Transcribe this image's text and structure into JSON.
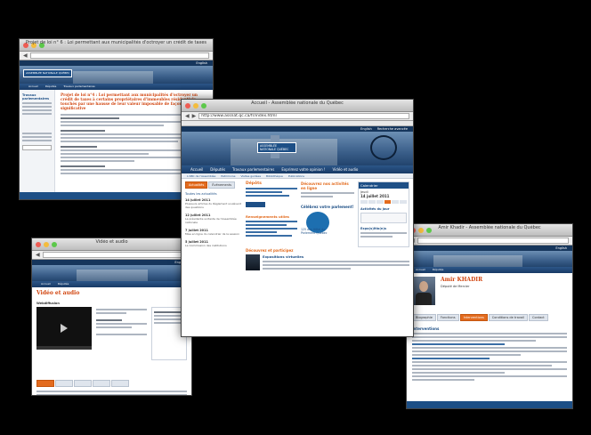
{
  "colors": {
    "background": "#000000",
    "brand_blue": "#1d4f86",
    "accent_orange": "#e36b1e",
    "title_red": "#d1440e"
  },
  "main": {
    "window_title": "Accueil - Assemblée nationale du Québec",
    "url": "http://www.assnat.qc.ca/fr/index.html",
    "search_label": "Recherche avancée",
    "nav_label": "English",
    "banner_logo": "ASSEMBLÉE NATIONALE QUÉBEC",
    "menu": [
      "Accueil",
      "Députés",
      "Travaux parlementaires",
      "Exprimez votre opinion !",
      "Vidéo et audio"
    ],
    "submenu": [
      "L'ABC de l'Assemblée",
      "Patrimoine",
      "Visites guidées",
      "Bibliothèque",
      "Publications"
    ],
    "tabs": [
      "Actualités",
      "Événements",
      "Dépôts"
    ],
    "news_link": "Toutes les actualités",
    "news": [
      {
        "date": "14 juillet 2011",
        "text": "Plusieurs articles du Règlement soulèvent des questions"
      },
      {
        "date": "12 juillet 2011",
        "text": "La présidente sortante de l'Assemblée nationale"
      },
      {
        "date": "7 juillet 2011",
        "text": "Mise en ligne du calendrier de la session"
      },
      {
        "date": "5 juillet 2011",
        "text": "La Commission des institutions"
      }
    ],
    "depots_title": "Dépôts",
    "renseignements_title": "Renseignements utiles",
    "decouvrez_title": "Découvrez et participez",
    "exposition_title": "Expositions virtuelles",
    "nouveau_title": "Découvrez nos activités en ligne",
    "celebrez_title": "Célébrez votre parlement!",
    "anniversary_text": "125 ans Hôtel du Parlement Québec",
    "calendar_title": "Calendrier",
    "calendar_day": "Jeudi",
    "calendar_date": "14 juillet 2011",
    "activites_title": "Activités du jour",
    "expo_title": "Expo(s)itio(n)s"
  },
  "topleft": {
    "window_title": "Projet de loi n° 6 : Loi permettant aux municipalités d'octroyer un crédit de taxes",
    "red_title": "Projet de loi n°4 : Loi permettant aux municipalités d'octroyer un crédit de taxes à certains propriétaires d'immeubles résidentiels touchés par une hausse de leur valeur imposable de façon significative",
    "side_title": "Travaux parlementaires"
  },
  "bottomleft": {
    "window_title": "Vidéo et audio",
    "title": "Vidéo et audio",
    "webdiffusion": "Webdiffusion"
  },
  "right": {
    "window_title": "Amir Khadir - Assemblée nationale du Québec",
    "name": "Amir KHADIR",
    "subtitle": "Député de Mercier",
    "tabs": [
      "Biographie",
      "Fonctions",
      "Interventions",
      "Conditions de travail",
      "Contact"
    ],
    "section": "Interventions"
  }
}
